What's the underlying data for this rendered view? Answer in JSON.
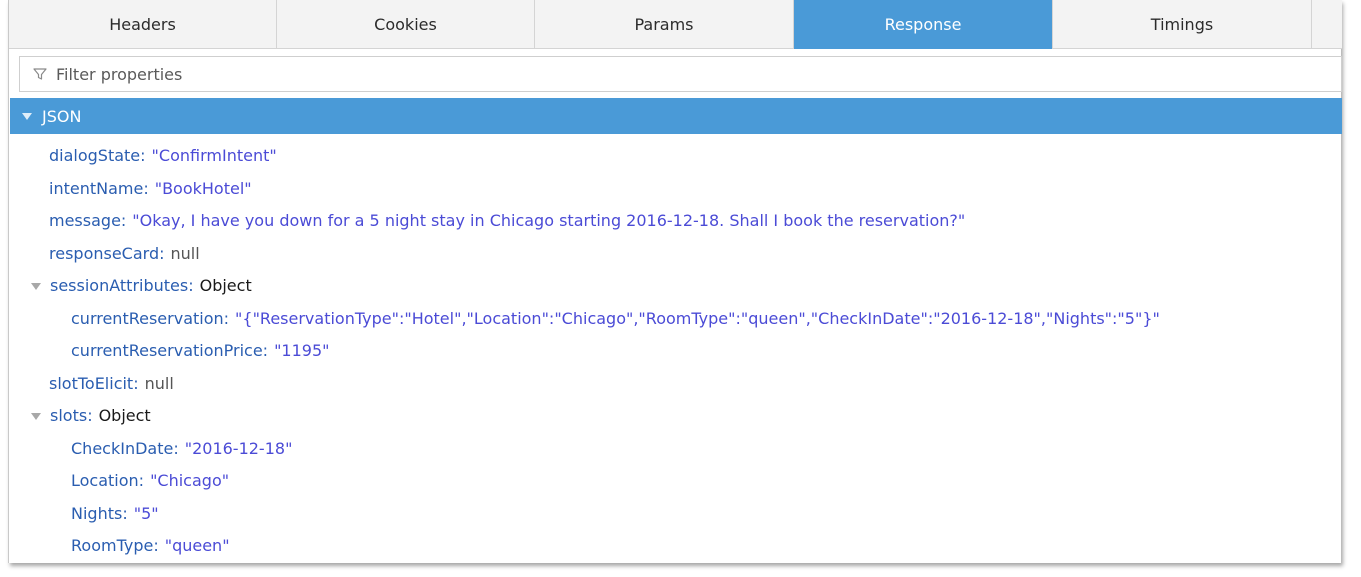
{
  "tabs": [
    {
      "label": "Headers",
      "active": false
    },
    {
      "label": "Cookies",
      "active": false
    },
    {
      "label": "Params",
      "active": false
    },
    {
      "label": "Response",
      "active": true
    },
    {
      "label": "Timings",
      "active": false
    }
  ],
  "filter": {
    "placeholder": "Filter properties",
    "icon": "funnel-icon"
  },
  "json_section": {
    "label": "JSON",
    "expanded": true
  },
  "tree": {
    "dialogState": {
      "key": "dialogState",
      "value": "\"ConfirmIntent\""
    },
    "intentName": {
      "key": "intentName",
      "value": "\"BookHotel\""
    },
    "message": {
      "key": "message",
      "value": "\"Okay, I have you down for a 5 night stay in Chicago starting 2016-12-18.  Shall I book the reservation?\""
    },
    "responseCard": {
      "key": "responseCard",
      "value": "null"
    },
    "sessionAttributes": {
      "key": "sessionAttributes",
      "value": "Object",
      "currentReservation": {
        "key": "currentReservation",
        "value": "\"{\"ReservationType\":\"Hotel\",\"Location\":\"Chicago\",\"RoomType\":\"queen\",\"CheckInDate\":\"2016-12-18\",\"Nights\":\"5\"}\""
      },
      "currentReservationPrice": {
        "key": "currentReservationPrice",
        "value": "\"1195\""
      }
    },
    "slotToElicit": {
      "key": "slotToElicit",
      "value": "null"
    },
    "slots": {
      "key": "slots",
      "value": "Object",
      "CheckInDate": {
        "key": "CheckInDate",
        "value": "\"2016-12-18\""
      },
      "Location": {
        "key": "Location",
        "value": "\"Chicago\""
      },
      "Nights": {
        "key": "Nights",
        "value": "\"5\""
      },
      "RoomType": {
        "key": "RoomType",
        "value": "\"queen\""
      }
    }
  },
  "colors": {
    "accent": "#4a9ad7",
    "key": "#2a5db0",
    "string": "#4b4bd6",
    "null": "#555555"
  }
}
